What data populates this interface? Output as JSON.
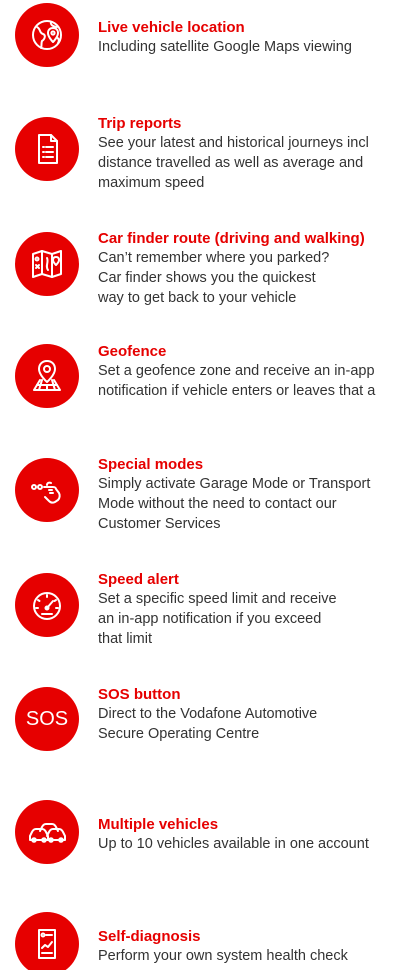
{
  "colors": {
    "accent": "#e60000",
    "text": "#333333",
    "background": "#ffffff"
  },
  "features": [
    {
      "icon": "globe-location-icon",
      "title": "Live vehicle location",
      "lines": [
        "Including satellite Google Maps viewing"
      ]
    },
    {
      "icon": "document-list-icon",
      "title": "Trip reports",
      "lines": [
        "See your latest and historical journeys incl",
        "distance travelled as well as average and",
        "maximum speed"
      ]
    },
    {
      "icon": "map-route-icon",
      "title": "Car finder route (driving and walking)",
      "lines": [
        "Can’t remember where you parked?",
        "Car finder shows you the quickest",
        "way to get back to your vehicle"
      ]
    },
    {
      "icon": "geofence-pin-icon",
      "title": "Geofence",
      "lines": [
        "Set a geofence zone and receive an in-app",
        "notification if vehicle enters or leaves that a"
      ]
    },
    {
      "icon": "hand-tap-icon",
      "title": "Special modes",
      "lines": [
        "Simply activate Garage Mode or Transport",
        "Mode without the need to contact our",
        "Customer Services"
      ]
    },
    {
      "icon": "speedometer-icon",
      "title": "Speed alert",
      "lines": [
        "Set a specific speed limit and receive",
        "an in-app notification if you exceed",
        "that limit"
      ]
    },
    {
      "icon": "sos-icon",
      "icon_text": "SOS",
      "title": "SOS button",
      "lines": [
        "Direct to the Vodafone Automotive",
        "Secure Operating Centre"
      ]
    },
    {
      "icon": "multiple-cars-icon",
      "title": "Multiple vehicles",
      "lines": [
        "Up to 10 vehicles available in one account"
      ]
    },
    {
      "icon": "health-report-icon",
      "title": "Self-diagnosis",
      "lines": [
        "Perform your own system health check"
      ]
    }
  ]
}
